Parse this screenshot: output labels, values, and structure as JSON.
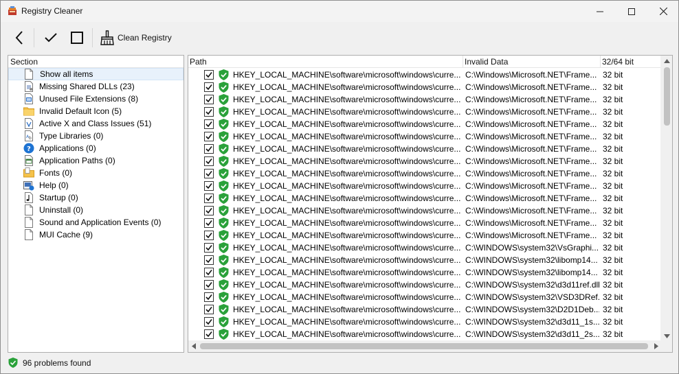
{
  "window": {
    "title": "Registry Cleaner"
  },
  "toolbar": {
    "clean_label": "Clean Registry"
  },
  "sections": {
    "header": "Section",
    "items": [
      {
        "label": "Show all items",
        "icon": "blank-page-icon",
        "selected": true
      },
      {
        "label": "Missing Shared DLLs (23)",
        "icon": "dll-file-icon"
      },
      {
        "label": "Unused File Extensions (8)",
        "icon": "file-extension-icon"
      },
      {
        "label": "Invalid Default Icon (5)",
        "icon": "folder-icon"
      },
      {
        "label": "Active X and Class Issues (51)",
        "icon": "activex-icon"
      },
      {
        "label": "Type Libraries (0)",
        "icon": "type-library-icon"
      },
      {
        "label": "Applications (0)",
        "icon": "help-circle-icon"
      },
      {
        "label": "Application Paths (0)",
        "icon": "application-path-icon"
      },
      {
        "label": "Fonts (0)",
        "icon": "fonts-folder-icon"
      },
      {
        "label": "Help (0)",
        "icon": "help-file-icon"
      },
      {
        "label": "Startup (0)",
        "icon": "music-file-icon"
      },
      {
        "label": "Uninstall (0)",
        "icon": "blank-page-icon"
      },
      {
        "label": "Sound and Application Events (0)",
        "icon": "blank-page-icon"
      },
      {
        "label": "MUI Cache (9)",
        "icon": "blank-page-icon"
      }
    ]
  },
  "grid": {
    "columns": [
      "Path",
      "Invalid Data",
      "32/64 bit"
    ],
    "rows": [
      {
        "path": "HKEY_LOCAL_MACHINE\\software\\microsoft\\windows\\curre...",
        "data": "C:\\Windows\\Microsoft.NET\\Frame...",
        "bit": "32 bit",
        "checked": true
      },
      {
        "path": "HKEY_LOCAL_MACHINE\\software\\microsoft\\windows\\curre...",
        "data": "C:\\Windows\\Microsoft.NET\\Frame...",
        "bit": "32 bit",
        "checked": true
      },
      {
        "path": "HKEY_LOCAL_MACHINE\\software\\microsoft\\windows\\curre...",
        "data": "C:\\Windows\\Microsoft.NET\\Frame...",
        "bit": "32 bit",
        "checked": true
      },
      {
        "path": "HKEY_LOCAL_MACHINE\\software\\microsoft\\windows\\curre...",
        "data": "C:\\Windows\\Microsoft.NET\\Frame...",
        "bit": "32 bit",
        "checked": true
      },
      {
        "path": "HKEY_LOCAL_MACHINE\\software\\microsoft\\windows\\curre...",
        "data": "C:\\Windows\\Microsoft.NET\\Frame...",
        "bit": "32 bit",
        "checked": true
      },
      {
        "path": "HKEY_LOCAL_MACHINE\\software\\microsoft\\windows\\curre...",
        "data": "C:\\Windows\\Microsoft.NET\\Frame...",
        "bit": "32 bit",
        "checked": true
      },
      {
        "path": "HKEY_LOCAL_MACHINE\\software\\microsoft\\windows\\curre...",
        "data": "C:\\Windows\\Microsoft.NET\\Frame...",
        "bit": "32 bit",
        "checked": true
      },
      {
        "path": "HKEY_LOCAL_MACHINE\\software\\microsoft\\windows\\curre...",
        "data": "C:\\Windows\\Microsoft.NET\\Frame...",
        "bit": "32 bit",
        "checked": true
      },
      {
        "path": "HKEY_LOCAL_MACHINE\\software\\microsoft\\windows\\curre...",
        "data": "C:\\Windows\\Microsoft.NET\\Frame...",
        "bit": "32 bit",
        "checked": true
      },
      {
        "path": "HKEY_LOCAL_MACHINE\\software\\microsoft\\windows\\curre...",
        "data": "C:\\Windows\\Microsoft.NET\\Frame...",
        "bit": "32 bit",
        "checked": true
      },
      {
        "path": "HKEY_LOCAL_MACHINE\\software\\microsoft\\windows\\curre...",
        "data": "C:\\Windows\\Microsoft.NET\\Frame...",
        "bit": "32 bit",
        "checked": true
      },
      {
        "path": "HKEY_LOCAL_MACHINE\\software\\microsoft\\windows\\curre...",
        "data": "C:\\Windows\\Microsoft.NET\\Frame...",
        "bit": "32 bit",
        "checked": true
      },
      {
        "path": "HKEY_LOCAL_MACHINE\\software\\microsoft\\windows\\curre...",
        "data": "C:\\Windows\\Microsoft.NET\\Frame...",
        "bit": "32 bit",
        "checked": true
      },
      {
        "path": "HKEY_LOCAL_MACHINE\\software\\microsoft\\windows\\curre...",
        "data": "C:\\Windows\\Microsoft.NET\\Frame...",
        "bit": "32 bit",
        "checked": true
      },
      {
        "path": "HKEY_LOCAL_MACHINE\\software\\microsoft\\windows\\curre...",
        "data": "C:\\WINDOWS\\system32\\VsGraphi...",
        "bit": "32 bit",
        "checked": true
      },
      {
        "path": "HKEY_LOCAL_MACHINE\\software\\microsoft\\windows\\curre...",
        "data": "C:\\WINDOWS\\system32\\libomp14...",
        "bit": "32 bit",
        "checked": true
      },
      {
        "path": "HKEY_LOCAL_MACHINE\\software\\microsoft\\windows\\curre...",
        "data": "C:\\WINDOWS\\system32\\libomp14...",
        "bit": "32 bit",
        "checked": true
      },
      {
        "path": "HKEY_LOCAL_MACHINE\\software\\microsoft\\windows\\curre...",
        "data": "C:\\WINDOWS\\system32\\d3d11ref.dll",
        "bit": "32 bit",
        "checked": true
      },
      {
        "path": "HKEY_LOCAL_MACHINE\\software\\microsoft\\windows\\curre...",
        "data": "C:\\WINDOWS\\system32\\VSD3DRef...",
        "bit": "32 bit",
        "checked": true
      },
      {
        "path": "HKEY_LOCAL_MACHINE\\software\\microsoft\\windows\\curre...",
        "data": "C:\\WINDOWS\\system32\\D2D1Deb...",
        "bit": "32 bit",
        "checked": true
      },
      {
        "path": "HKEY_LOCAL_MACHINE\\software\\microsoft\\windows\\curre...",
        "data": "C:\\WINDOWS\\system32\\d3d11_1s...",
        "bit": "32 bit",
        "checked": true
      },
      {
        "path": "HKEY_LOCAL_MACHINE\\software\\microsoft\\windows\\curre...",
        "data": "C:\\WINDOWS\\system32\\d3d11_2s...",
        "bit": "32 bit",
        "checked": true
      }
    ]
  },
  "status": {
    "text": "96 problems found"
  },
  "colors": {
    "shield_green": "#2aa13a",
    "selection_bg": "#e8f1fb",
    "scrollbar_thumb": "#c2c2c2"
  }
}
